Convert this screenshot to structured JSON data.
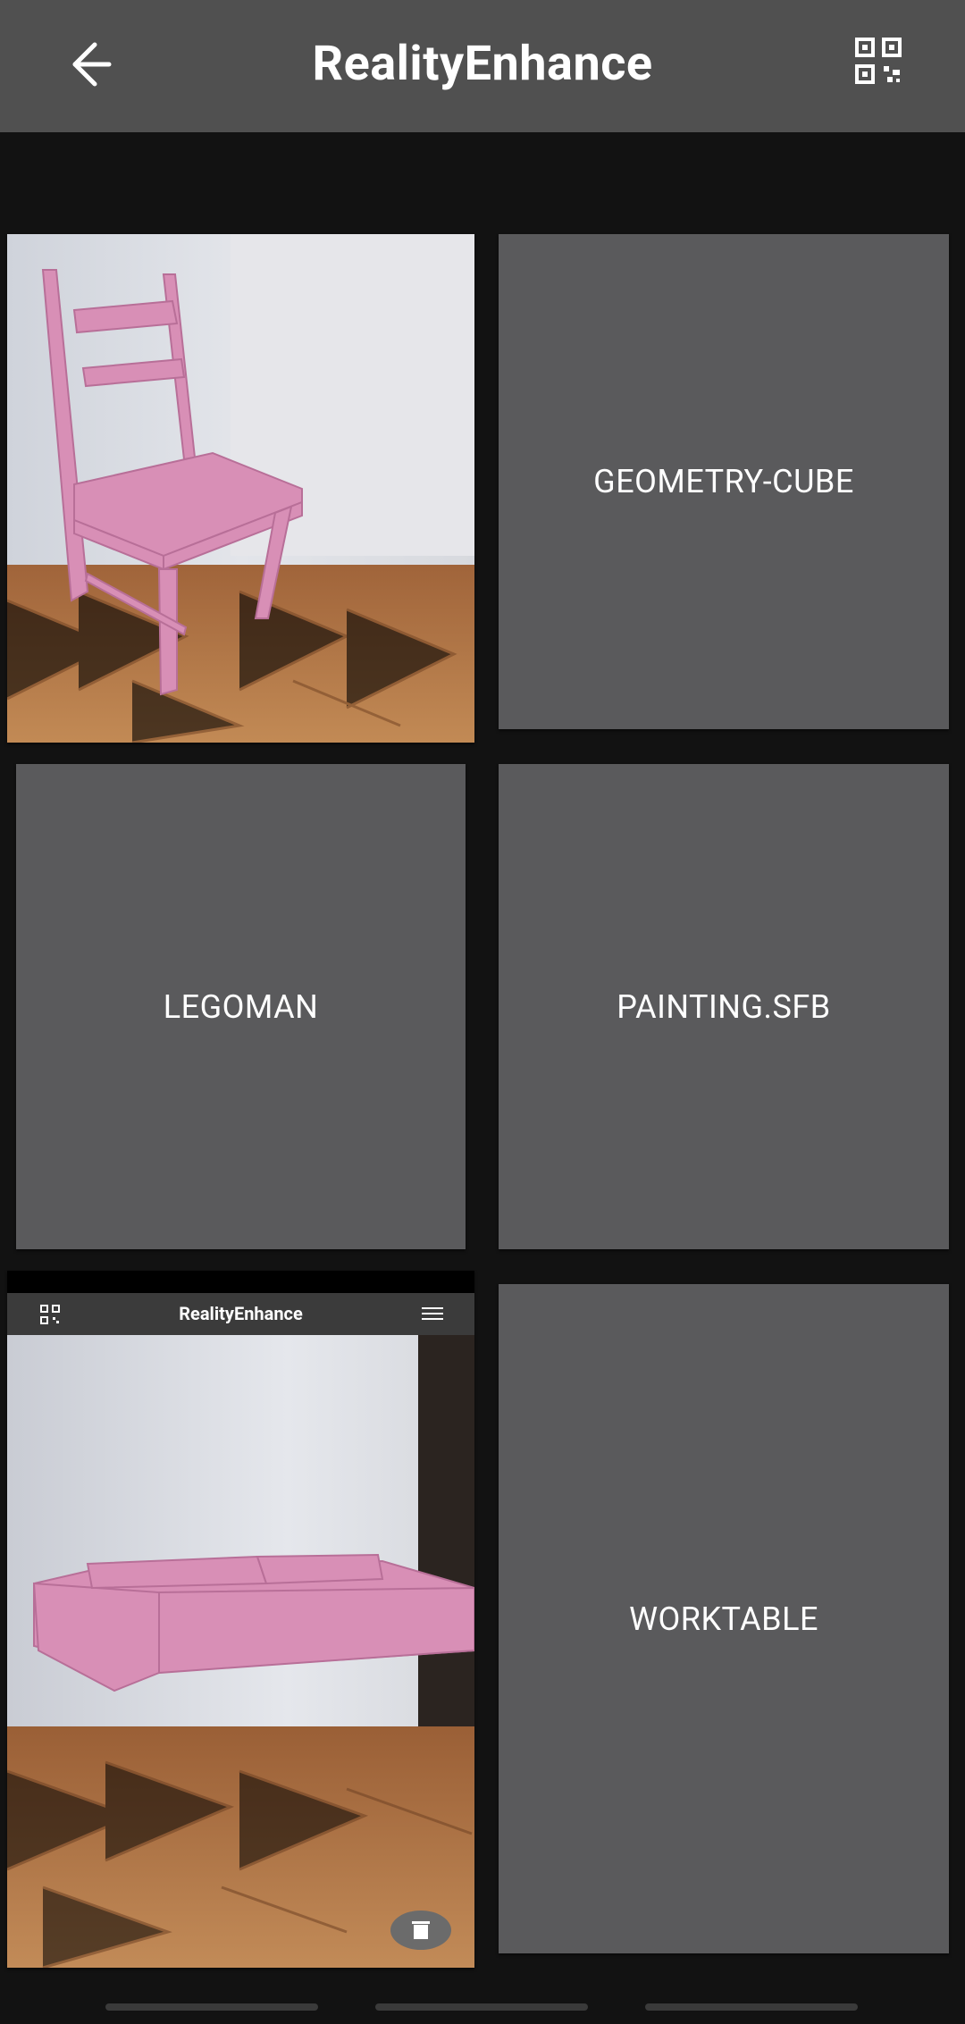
{
  "app": {
    "title": "RealityEnhance"
  },
  "models": [
    {
      "label": ""
    },
    {
      "label": "GEOMETRY-CUBE"
    },
    {
      "label": "LEGOMAN"
    },
    {
      "label": "PAINTING.SFB"
    },
    {
      "label": ""
    },
    {
      "label": "WORKTABLE"
    }
  ],
  "preview": {
    "mini_title": "RealityEnhance"
  },
  "icons": {
    "back": "arrow-left-icon",
    "qr": "qr-code-icon",
    "menu": "menu-icon",
    "delete": "trash-icon"
  },
  "colors": {
    "appbar": "#505050",
    "background": "#121212",
    "tile": "#5a5a5c",
    "pink_model": "#d88fb6"
  }
}
